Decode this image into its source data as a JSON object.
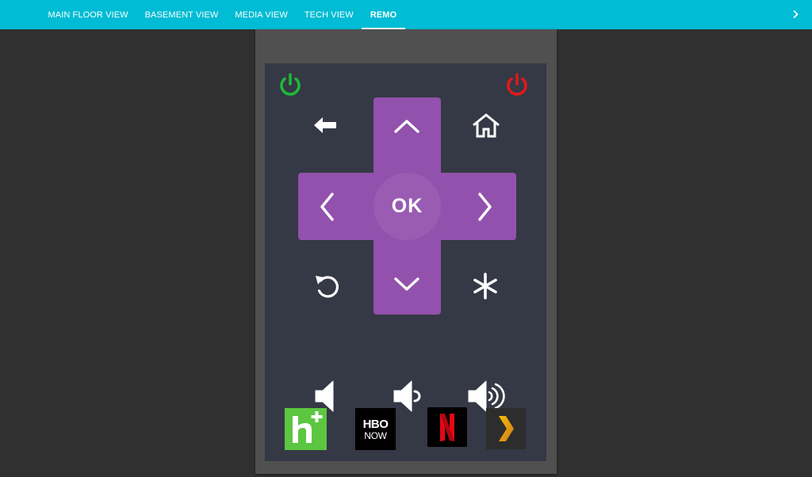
{
  "tabs": [
    {
      "label": "MAIN FLOOR VIEW",
      "active": false
    },
    {
      "label": "BASEMENT VIEW",
      "active": false
    },
    {
      "label": "MEDIA VIEW",
      "active": false
    },
    {
      "label": "TECH VIEW",
      "active": false
    },
    {
      "label": "REMO",
      "active": true
    }
  ],
  "remote": {
    "ok_label": "OK",
    "power_on_color": "#1db936",
    "power_off_color": "#e0191b",
    "dpad_color": "#9251ac"
  },
  "apps": {
    "hbo_line1": "HBO",
    "hbo_line2": "NOW"
  },
  "icons": [
    "power-on-icon",
    "power-off-icon",
    "back-arrow-icon",
    "home-icon",
    "chevron-up-icon",
    "chevron-left-icon",
    "chevron-right-icon",
    "chevron-down-icon",
    "replay-icon",
    "asterisk-icon",
    "volume-mute-icon",
    "volume-down-icon",
    "volume-up-icon",
    "chevron-right-icon"
  ]
}
